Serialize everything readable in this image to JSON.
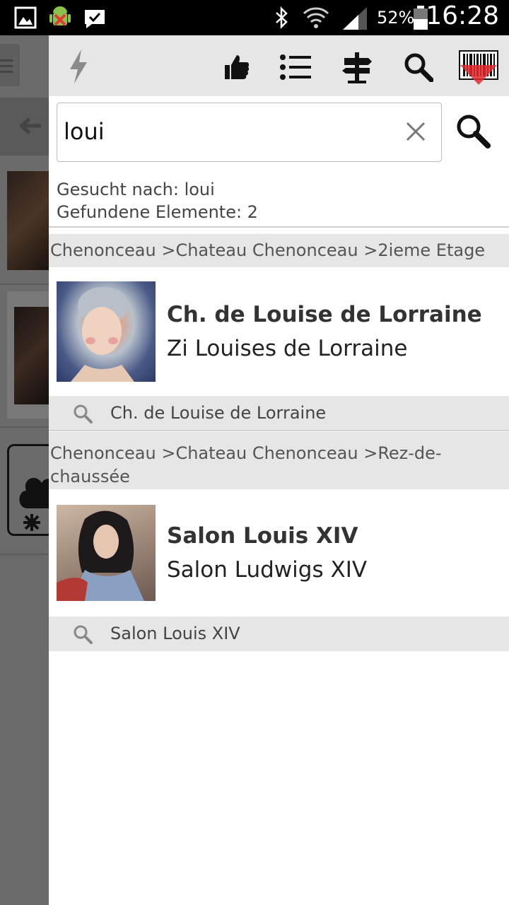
{
  "status_bar": {
    "battery_pct": "52%",
    "time": "16:28",
    "icons": [
      "gallery-icon",
      "android-debug-icon",
      "check-bubble-icon",
      "bluetooth-icon",
      "wifi-icon",
      "signal-icon",
      "battery-icon"
    ]
  },
  "toolbar": {
    "icons": [
      "flash-icon",
      "thumbs-up-icon",
      "list-icon",
      "signpost-icon",
      "search-icon",
      "barcode-scanner-icon"
    ]
  },
  "search": {
    "query": "loui"
  },
  "info": {
    "searched_for": "Gesucht nach: loui",
    "found_items": "Gefundene Elemente: 2"
  },
  "results": [
    {
      "breadcrumb": "Chenonceau >Chateau Chenonceau >2ieme Etage",
      "title": "Ch. de Louise de Lorraine",
      "subtitle": "Zi Louises de Lorraine",
      "search_label": "Ch. de Louise de Lorraine"
    },
    {
      "breadcrumb": "Chenonceau >Chateau Chenonceau >Rez-de-chaussée",
      "title": "Salon Louis XIV",
      "subtitle": "Salon Ludwigs XIV",
      "search_label": "Salon Louis XIV"
    }
  ],
  "colors": {
    "status_bar": "#000000",
    "toolbar": "#e6e6e6",
    "section": "#e6e6e6",
    "dim_overlay": "#6b6b6b",
    "scanner_red": "#e5282d"
  }
}
